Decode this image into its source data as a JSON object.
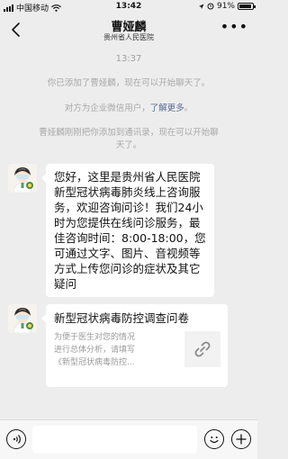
{
  "status_bar": {
    "carrier": "中国移动",
    "time": "13:42",
    "battery": "91%",
    "battery_level": 0.91
  },
  "nav": {
    "title": "曹娅麟",
    "subtitle": "贵州省人民医院"
  },
  "chat": {
    "time_label": "13:37",
    "system_added": "你已添加了曹娅麟，现在可以开始聊天了。",
    "system_enterprise": "对方为企业微信用户，",
    "system_enterprise_link": "了解更多",
    "system_enterprise_end": "。",
    "system_contacts_line1": "曹娅麟刚刚把你添加到通讯录，现在可以开始聊",
    "system_contacts_line2": "天了。",
    "message_text": "您好，这里是贵州省人民医院新型冠状病毒肺炎线上咨询服务，欢迎咨询问诊！我们24小时为您提供在线问诊服务，最佳咨询时间：8:00-18:00，您可通过文字、图片、音视频等方式上传您问诊的症状及其它疑问",
    "card": {
      "title": "新型冠状病毒防控调查问卷",
      "desc_line1": "为便于医生对您的情况",
      "desc_line2": "进行总体分析，请填写",
      "desc_line3": "《新型冠状病毒防控...",
      "icon": "link-icon"
    }
  },
  "input_bar": {
    "voice_icon": "voice-icon",
    "emoji_icon": "emoji-icon",
    "plus_icon": "plus-icon"
  }
}
